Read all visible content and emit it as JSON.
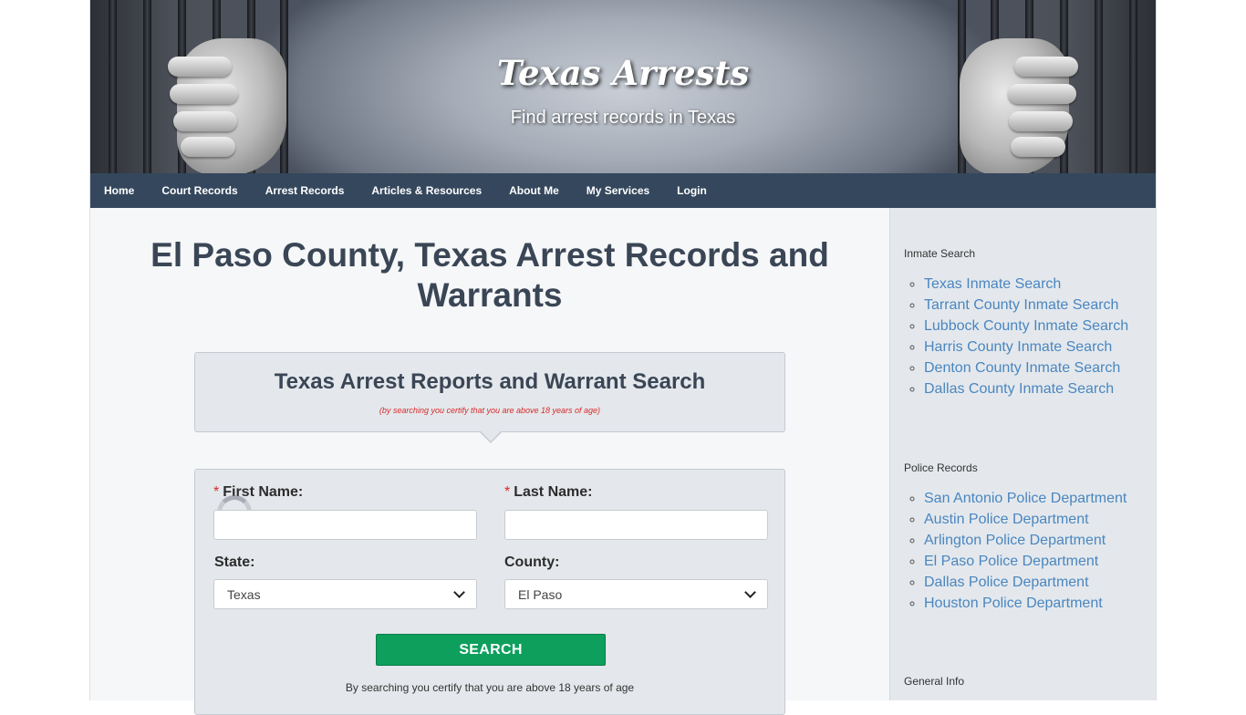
{
  "header": {
    "title": "Texas Arrests",
    "tagline": "Find arrest records in Texas"
  },
  "nav": {
    "items": [
      "Home",
      "Court Records",
      "Arrest Records",
      "Articles & Resources",
      "About Me",
      "My Services",
      "Login"
    ]
  },
  "main": {
    "page_title": "El Paso County, Texas Arrest Records and Warrants",
    "search_panel": {
      "title": "Texas Arrest Reports and Warrant Search",
      "note": "(by searching you certify that you are above 18 years of age)"
    },
    "form": {
      "required_mark": "*",
      "first_name_label": "First Name:",
      "first_name_value": "",
      "last_name_label": "Last Name:",
      "last_name_value": "",
      "state_label": "State:",
      "state_value": "Texas",
      "county_label": "County:",
      "county_value": "El Paso",
      "search_button": "SEARCH",
      "certify_text": "By searching you certify that you are above 18 years of age"
    }
  },
  "sidebar": {
    "sections": [
      {
        "heading": "Inmate Search",
        "links": [
          "Texas Inmate Search",
          "Tarrant County Inmate Search",
          "Lubbock County Inmate Search",
          "Harris County Inmate Search",
          "Denton County Inmate Search",
          "Dallas County Inmate Search"
        ]
      },
      {
        "heading": "Police Records",
        "links": [
          "San Antonio Police Department",
          "Austin Police Department",
          "Arlington Police Department",
          "El Paso Police Department",
          "Dallas Police Department",
          "Houston Police Department"
        ]
      },
      {
        "heading": "General Info",
        "links": []
      }
    ]
  },
  "colors": {
    "nav_bg": "#34475d",
    "title_text": "#3a4656",
    "button_green": "#0e9f5d",
    "link_blue": "#4a86c0",
    "required_red": "#d62b2b"
  }
}
